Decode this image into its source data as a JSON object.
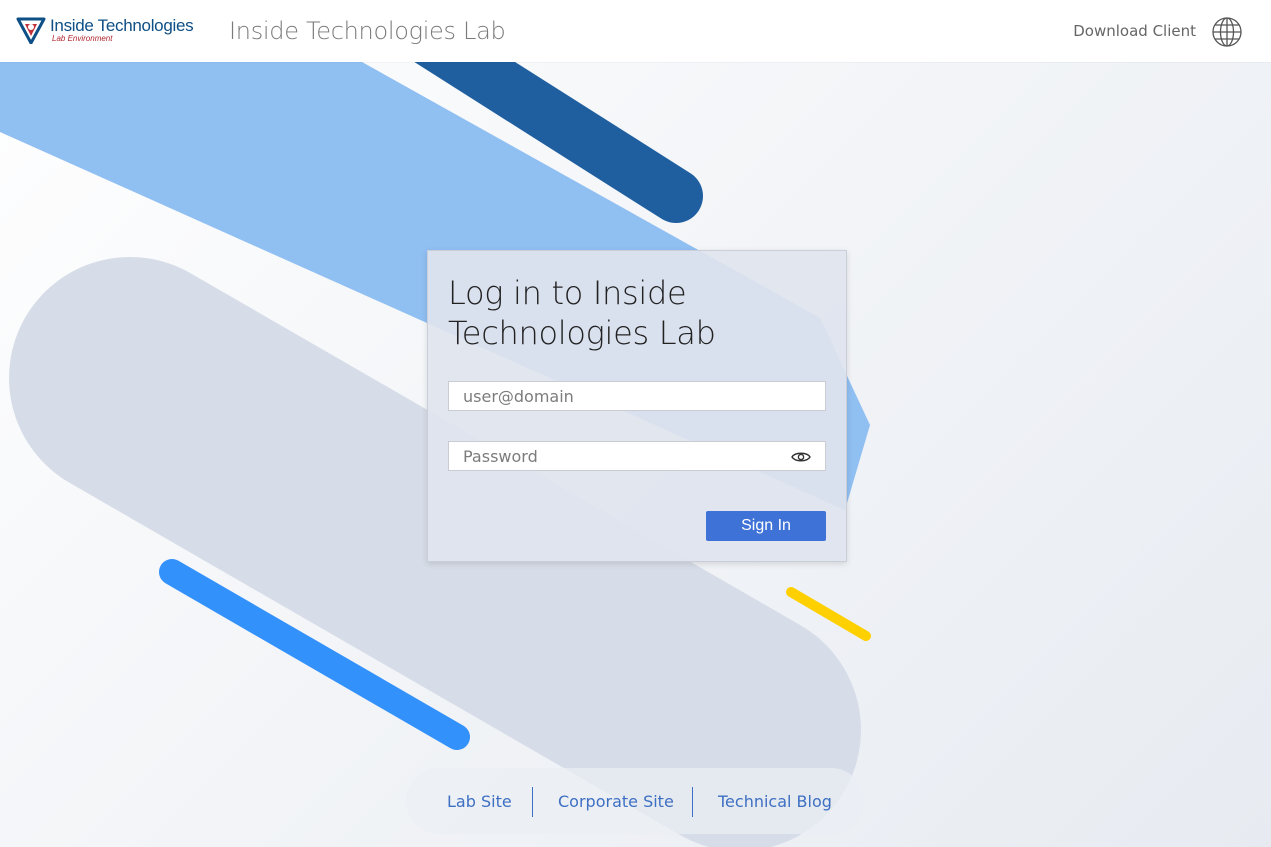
{
  "header": {
    "logo_main": "Inside Technologies",
    "logo_sub": "Lab Environment",
    "app_title": "Inside Technologies Lab",
    "download_label": "Download Client",
    "language_icon": "globe-icon"
  },
  "login": {
    "title": "Log in to Inside Technologies Lab",
    "username_placeholder": "user@domain",
    "password_placeholder": "Password",
    "show_password_icon": "eye-icon",
    "signin_label": "Sign In"
  },
  "footer": {
    "links": [
      "Lab Site",
      "Corporate Site",
      "Technical Blog"
    ]
  },
  "colors": {
    "brand_blue": "#0d4f86",
    "button_blue": "#3f72d7",
    "link_blue": "#3d6fc2",
    "light_blue_shape": "#90bff2",
    "dark_blue_shape": "#1f5fa0",
    "bright_blue_shape": "#3391fb",
    "yellow_shape": "#ffd000",
    "gray_shape": "#d7dde8"
  }
}
